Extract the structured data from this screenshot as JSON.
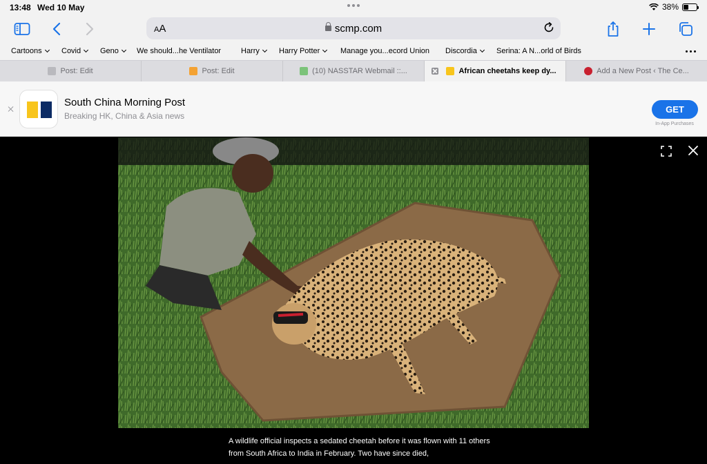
{
  "status_bar": {
    "time": "13:48",
    "date": "Wed 10 May",
    "battery": "38%",
    "battery_level": 0.38
  },
  "toolbar": {
    "text_size_label": "AA",
    "url": "scmp.com",
    "icons": [
      "sidebar-icon",
      "back-icon",
      "forward-icon",
      "lock-icon",
      "reload-icon",
      "share-icon",
      "new-tab-icon",
      "tabs-overview-icon"
    ]
  },
  "favorites": [
    {
      "label": "Cartoons",
      "folder": true
    },
    {
      "label": "Covid",
      "folder": true
    },
    {
      "label": "Geno",
      "folder": true
    },
    {
      "label": "We should...he Ventilator",
      "folder": false
    },
    {
      "label": "Harry",
      "folder": true
    },
    {
      "label": "Harry Potter",
      "folder": true
    },
    {
      "label": "Manage you...ecord Union",
      "folder": false
    },
    {
      "label": "Discordia",
      "folder": true
    },
    {
      "label": "Serina: A N...orld of Birds",
      "folder": false
    }
  ],
  "tabs": [
    {
      "label": "Post: Edit",
      "active": false,
      "favicon_color": "#b9b9be"
    },
    {
      "label": "Post: Edit",
      "active": false,
      "favicon_color": "#f4a233"
    },
    {
      "label": "(10) NASSTAR Webmail ::...",
      "active": false,
      "favicon_color": "#7cc37a"
    },
    {
      "label": "African cheetahs keep dy...",
      "active": true,
      "favicon_color": "#f8c51c"
    },
    {
      "label": "Add a New Post ‹ The Ce...",
      "active": false,
      "favicon_color": "#c8202f"
    }
  ],
  "app_banner": {
    "name": "South China Morning Post",
    "subtitle": "Breaking HK, China & Asia news",
    "button": "GET",
    "note": "In-App Purchases",
    "brand_colors": {
      "yellow": "#f8c51c",
      "navy": "#0c2b64",
      "button": "#1a73e8"
    }
  },
  "viewer": {
    "icons": [
      "fullscreen-icon",
      "close-icon"
    ],
    "caption": "A wildlife official inspects a sedated cheetah before it was flown with 11 others from South Africa to India in February. Two have since died,"
  }
}
